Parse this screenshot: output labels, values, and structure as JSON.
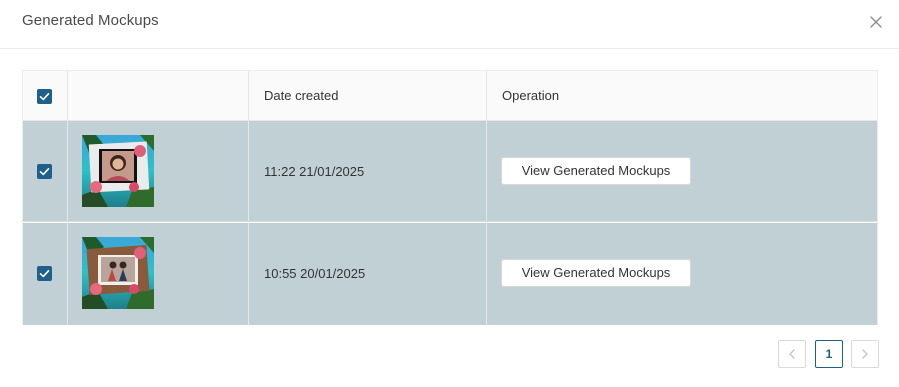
{
  "modal": {
    "title": "Generated Mockups",
    "close_icon": "close-icon"
  },
  "table": {
    "headers": {
      "select_all": "",
      "preview": "",
      "date_created": "Date created",
      "operation": "Operation"
    },
    "select_all_checked": true,
    "rows": [
      {
        "checked": true,
        "thumbnail": "mockup-thumbnail-portrait",
        "date_created": "11:22 21/01/2025",
        "action_label": "View Generated Mockups"
      },
      {
        "checked": true,
        "thumbnail": "mockup-thumbnail-couple",
        "date_created": "10:55 20/01/2025",
        "action_label": "View Generated Mockups"
      }
    ]
  },
  "pagination": {
    "prev_icon": "chevron-left-icon",
    "current_page": "1",
    "next_icon": "chevron-right-icon"
  },
  "colors": {
    "accent": "#1f5f8b",
    "selected_row_bg": "#c0d0d5",
    "header_bg": "#fafafa"
  }
}
